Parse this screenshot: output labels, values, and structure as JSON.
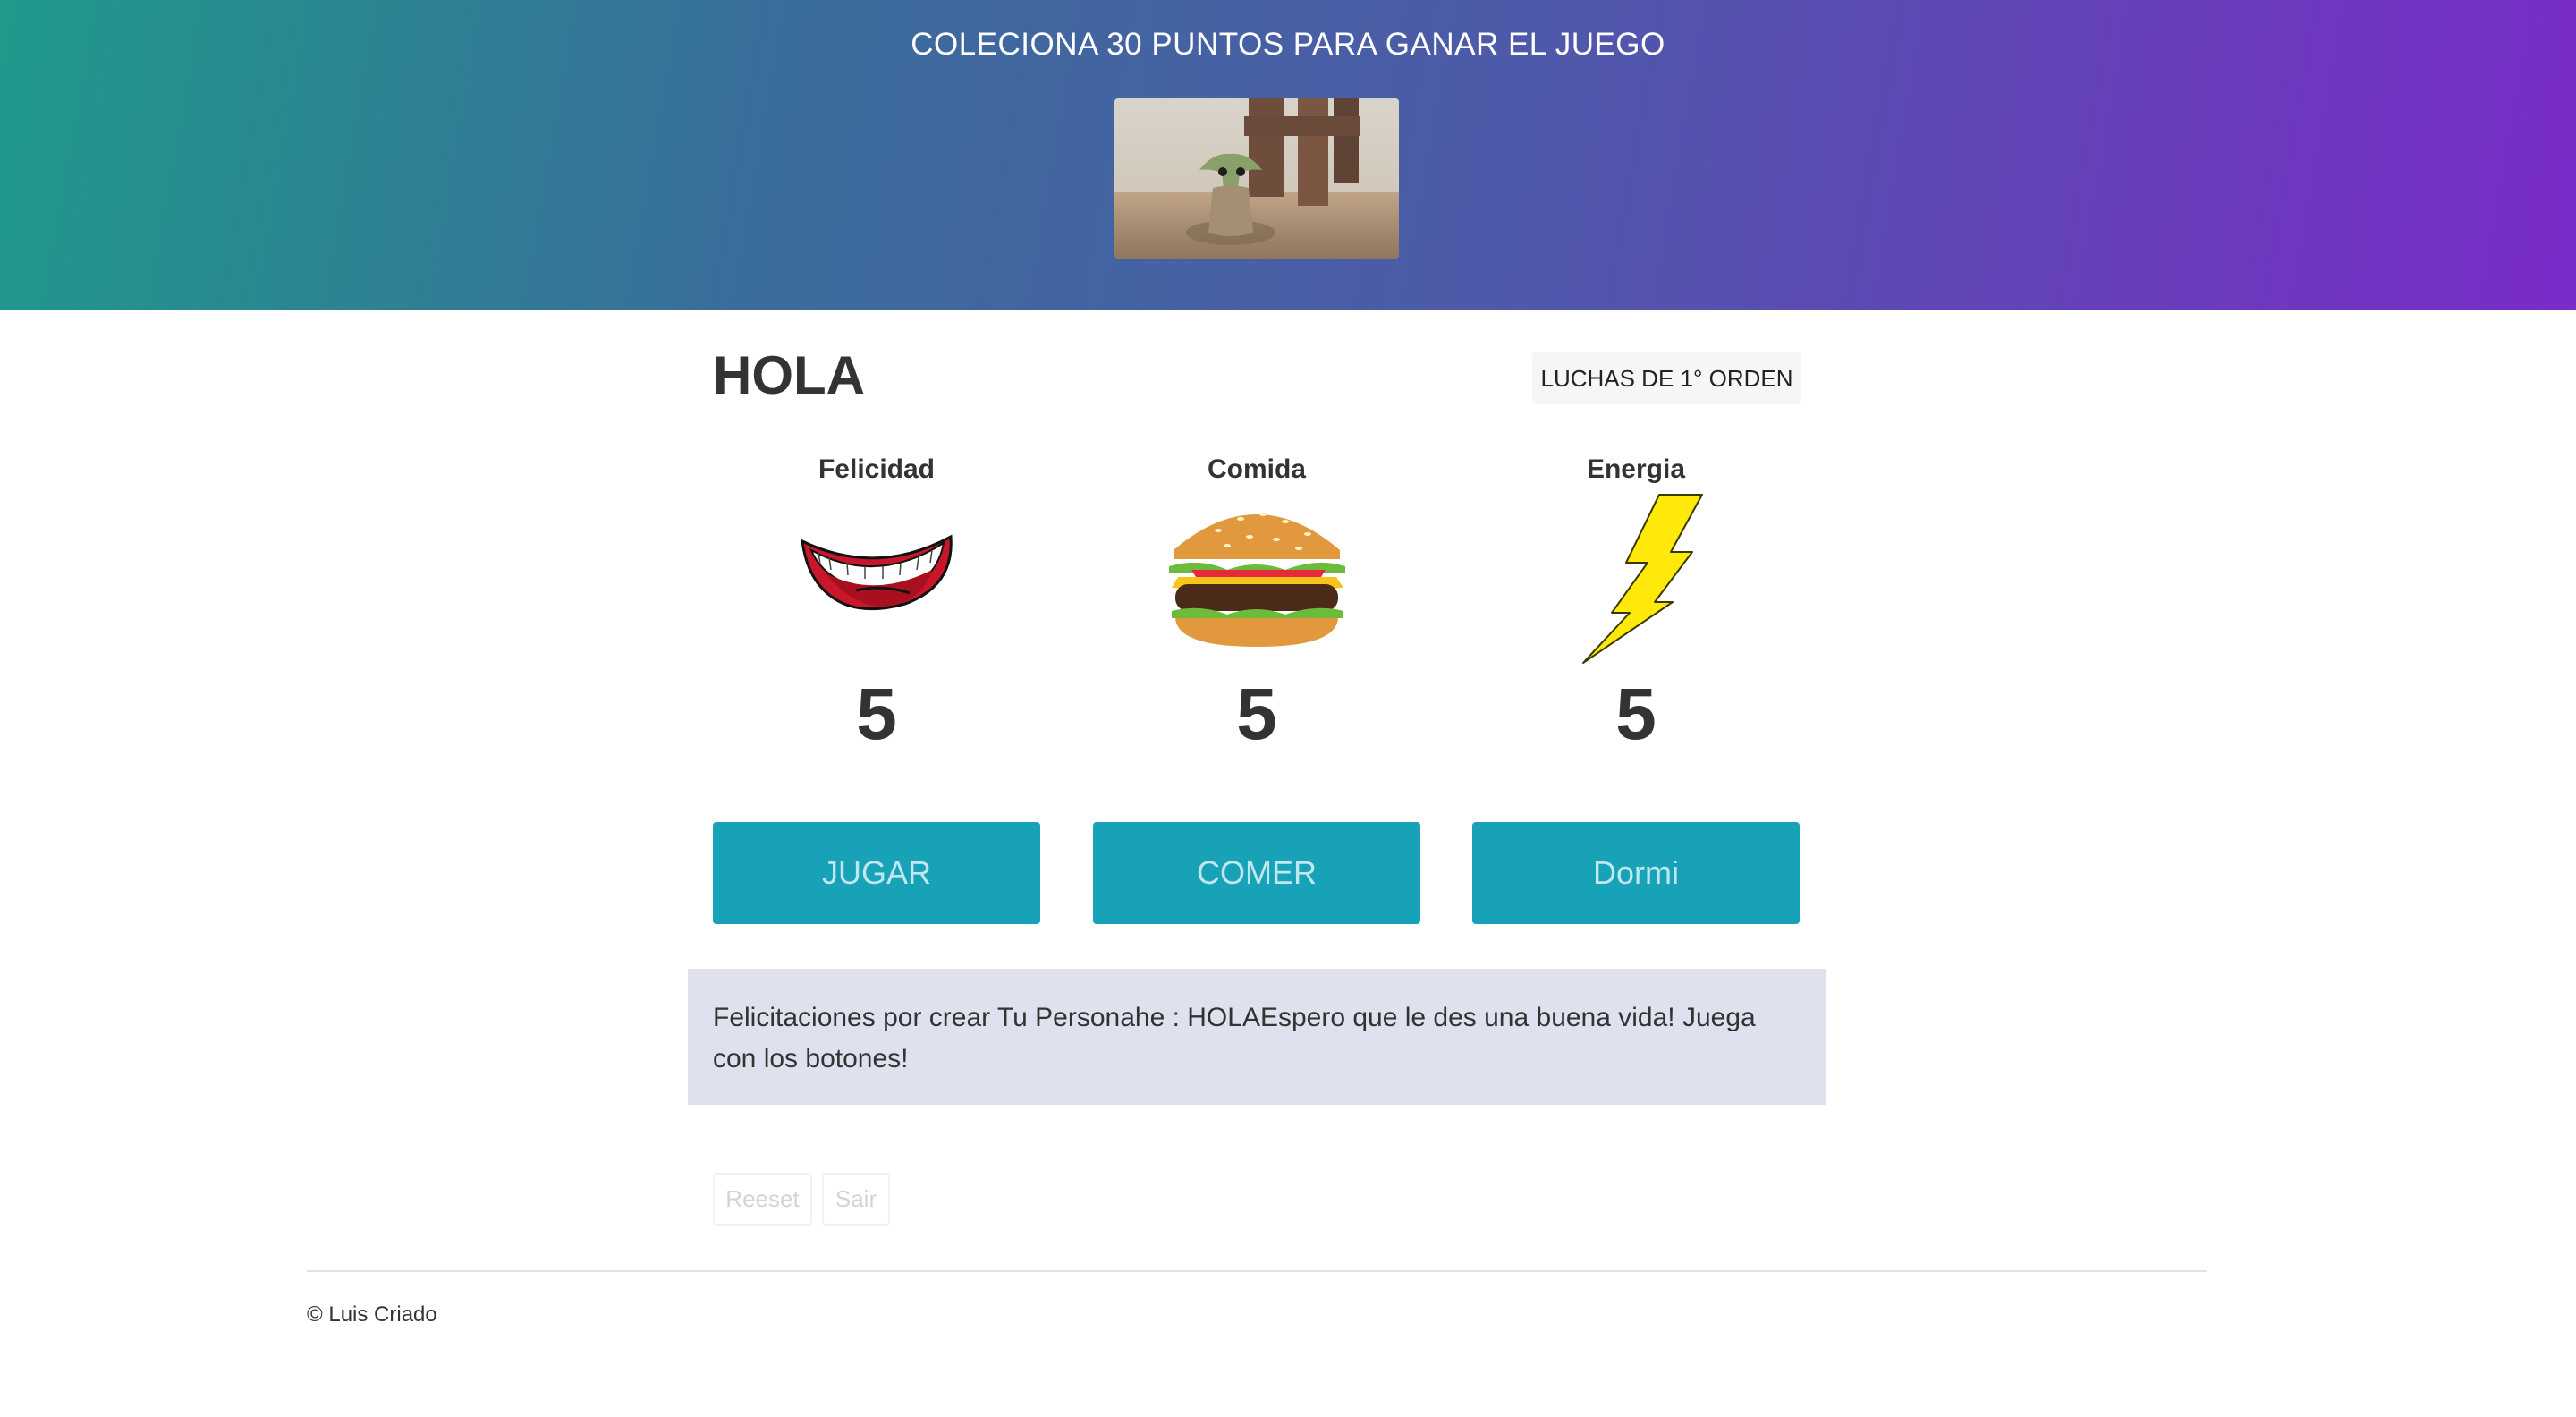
{
  "header": {
    "title": "COLECIONA 30 PUNTOS PARA GANAR EL JUEGO",
    "image_icon": "baby-yoda-photo"
  },
  "character": {
    "name": "HOLA",
    "team": "LUCHAS DE 1° ORDEN"
  },
  "stats": [
    {
      "label": "Felicidad",
      "icon": "mouth-smile-icon",
      "value": "5"
    },
    {
      "label": "Comida",
      "icon": "burger-icon",
      "value": "5"
    },
    {
      "label": "Energia",
      "icon": "lightning-icon",
      "value": "5"
    }
  ],
  "actions": {
    "play": "JUGAR",
    "eat": "COMER",
    "sleep": "Dormi"
  },
  "message": "Felicitaciones por crear Tu Personahe : HOLAEspero que le des una buena vida! Juega con los botones!",
  "controls": {
    "reset": "Reeset",
    "exit": "Sair"
  },
  "footer": {
    "copyright": "© Luis Criado"
  },
  "colors": {
    "accent": "#17a2b8",
    "message_bg": "#dfe2ee",
    "header_gradient_start": "#1f9a8b",
    "header_gradient_end": "#7a2bc8"
  }
}
